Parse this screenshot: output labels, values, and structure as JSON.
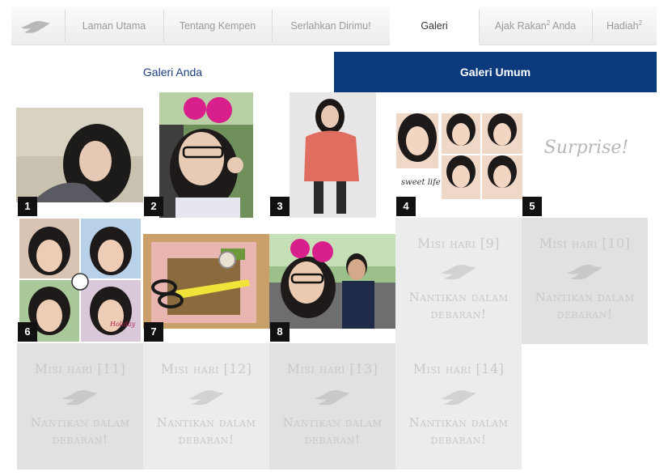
{
  "nav": {
    "items": [
      {
        "label": "Laman Utama",
        "sup": ""
      },
      {
        "label": "Tentang Kempen",
        "sup": ""
      },
      {
        "label": "Serlahkan Dirimu!",
        "sup": ""
      },
      {
        "label": "Galeri",
        "sup": ""
      },
      {
        "label": "Ajak Rakan",
        "sup": "2",
        "suffix": " Anda"
      },
      {
        "label": "Hadiah",
        "sup": "2"
      }
    ],
    "active_index": 3
  },
  "tabs": {
    "own": "Galeri Anda",
    "public": "Galeri Umum"
  },
  "gallery": {
    "photos": [
      {
        "number": "1"
      },
      {
        "number": "2"
      },
      {
        "number": "3"
      },
      {
        "number": "4",
        "caption": "sweet life"
      },
      {
        "number": "5",
        "caption": "Surprise!"
      },
      {
        "number": "6",
        "caption": "Holiday"
      },
      {
        "number": "7"
      },
      {
        "number": "8"
      }
    ],
    "pending": [
      {
        "title": "Misi hari [9]",
        "subtitle": "Nantikan dalam debaran!"
      },
      {
        "title": "Misi hari [10]",
        "subtitle": "Nantikan dalam debaran!"
      },
      {
        "title": "Misi hari [11]",
        "subtitle": "Nantikan dalam debaran!"
      },
      {
        "title": "Misi hari [12]",
        "subtitle": "Nantikan dalam debaran!"
      },
      {
        "title": "Misi hari [13]",
        "subtitle": "Nantikan dalam debaran!"
      },
      {
        "title": "Misi hari [14]",
        "subtitle": "Nantikan dalam debaran!"
      }
    ]
  },
  "colors": {
    "brand_blue": "#0a3a7c",
    "tile_light": "#ececec",
    "tile_dark": "#e1e1e1"
  },
  "icons": {
    "logo": "dove-icon"
  }
}
